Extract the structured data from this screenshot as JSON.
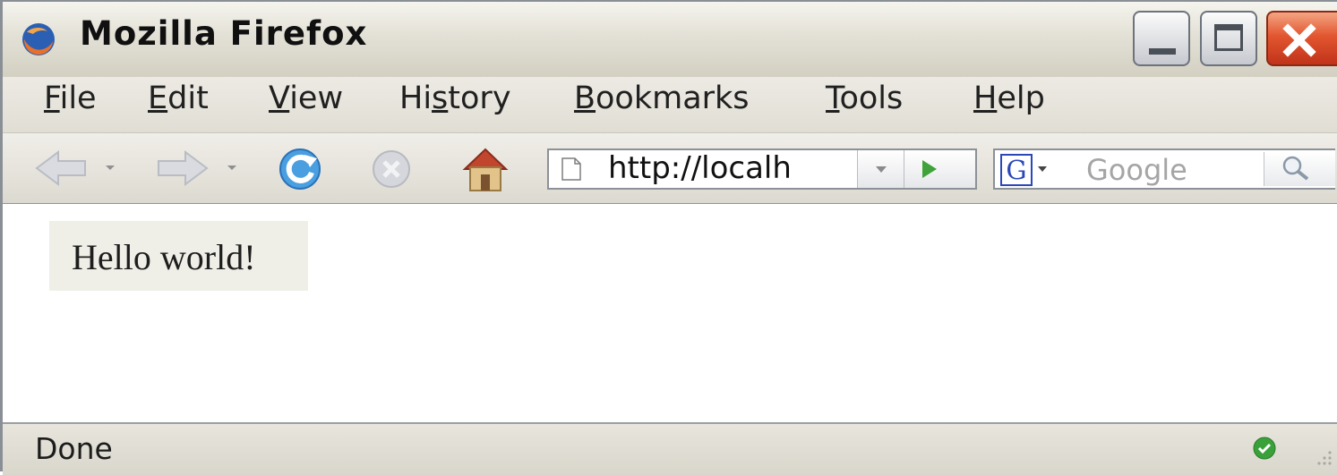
{
  "window": {
    "title": "Mozilla Firefox",
    "controls": {
      "minimize": "minimize-icon",
      "maximize": "maximize-icon",
      "close": "close-icon"
    },
    "close_color": "#d7482a"
  },
  "menu": {
    "items": [
      {
        "label": "File",
        "accesskey": "F"
      },
      {
        "label": "Edit",
        "accesskey": "E"
      },
      {
        "label": "View",
        "accesskey": "V"
      },
      {
        "label": "History",
        "accesskey": "s"
      },
      {
        "label": "Bookmarks",
        "accesskey": "B"
      },
      {
        "label": "Tools",
        "accesskey": "T"
      },
      {
        "label": "Help",
        "accesskey": "H"
      }
    ]
  },
  "toolbar": {
    "icons": [
      "back-arrow-icon",
      "forward-arrow-icon",
      "reload-icon",
      "stop-icon",
      "home-icon"
    ],
    "url": "http://localh",
    "search_engine_letter": "G",
    "search_placeholder": "Google"
  },
  "content": {
    "text": "Hello world!"
  },
  "statusbar": {
    "text": "Done",
    "icon": "green-check-icon",
    "status_color": "#3aa13a"
  }
}
